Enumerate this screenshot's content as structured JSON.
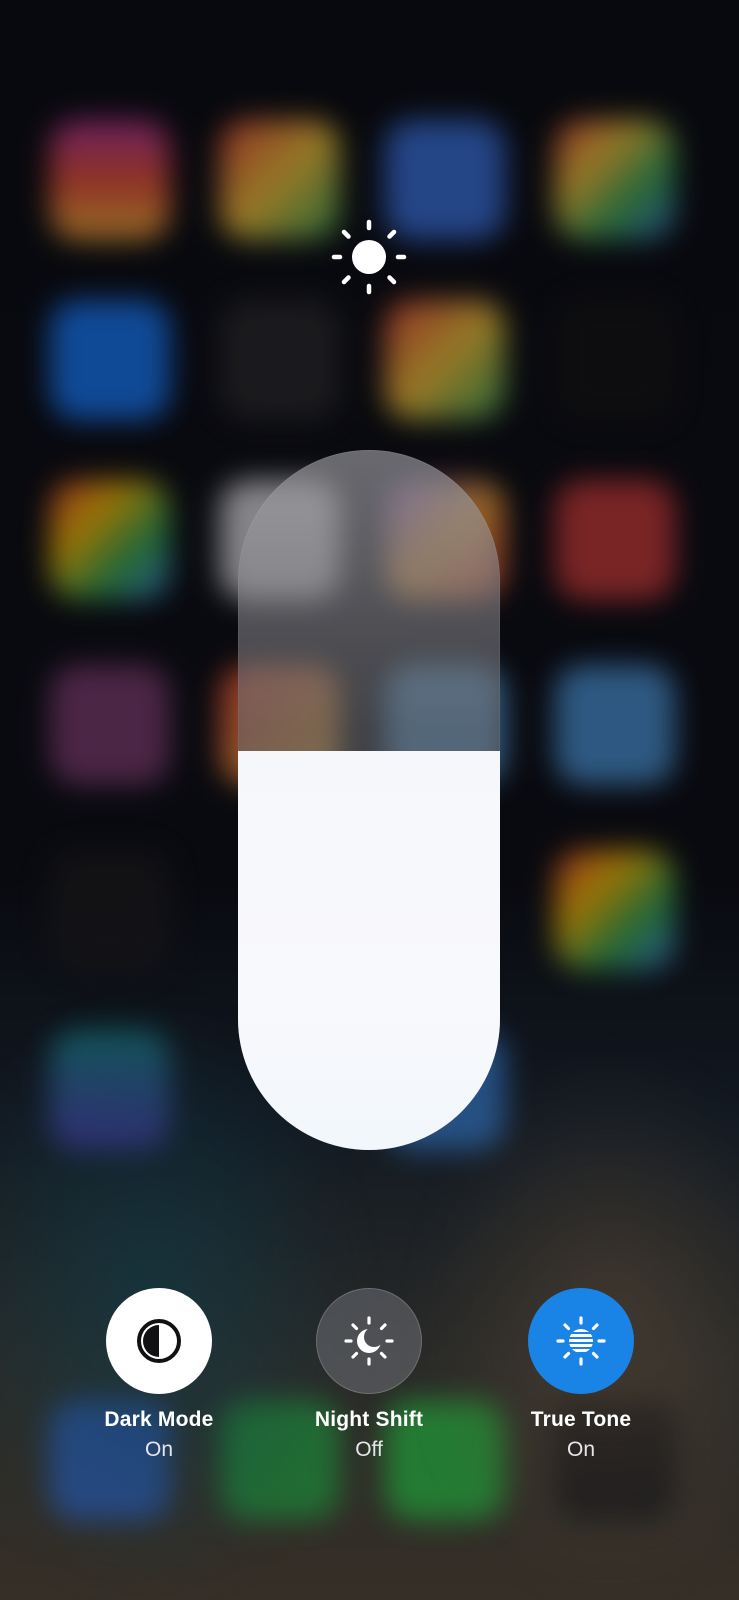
{
  "brightness": {
    "icon": "sun-icon",
    "level": 0.57
  },
  "toggles": [
    {
      "icon": "dark-mode-icon",
      "title": "Dark Mode",
      "state": "On",
      "active_color": "#ffffff"
    },
    {
      "icon": "night-shift-icon",
      "title": "Night Shift",
      "state": "Off",
      "active_color": "#6e7076"
    },
    {
      "icon": "true-tone-icon",
      "title": "True Tone",
      "state": "On",
      "active_color": "#1a83e6"
    }
  ]
}
